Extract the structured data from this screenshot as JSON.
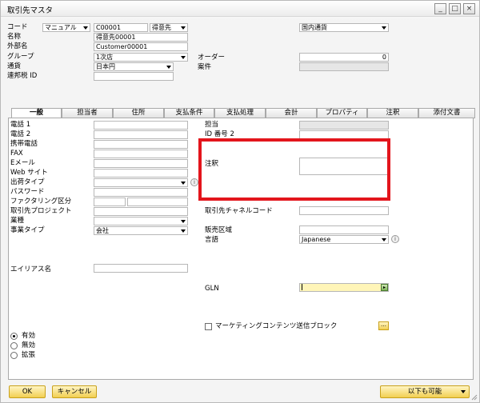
{
  "window": {
    "title": "取引先マスタ",
    "minimize_glyph": "_",
    "maximize_glyph": "□",
    "close_glyph": "×"
  },
  "header": {
    "code_label": "コード",
    "code_mode": "マニュアル",
    "code_value": "C00001",
    "type_value": "得意先",
    "name_label": "名称",
    "name_value": "得意先00001",
    "foreign_name_label": "外部名",
    "foreign_name_value": "Customer00001",
    "group_label": "グループ",
    "group_value": "1次店",
    "currency_label": "通貨",
    "currency_value": "日本円",
    "federal_tax_label": "連邦税 ID",
    "federal_tax_value": "",
    "currency_type_value": "国内通貨",
    "orders_label": "オーダー",
    "orders_value": "0",
    "projects_label": "案件",
    "projects_value": ""
  },
  "tabs": [
    "一般",
    "担当者",
    "住所",
    "支払条件",
    "支払処理",
    "会計",
    "プロパティ",
    "注釈",
    "添付文書"
  ],
  "general": {
    "left_labels": [
      "電話 1",
      "電話 2",
      "携帯電話",
      "FAX",
      "Eメール",
      "Web サイト",
      "出荷タイプ",
      "パスワード",
      "ファクタリング区分",
      "取引先プロジェクト",
      "業種",
      "事業タイプ"
    ],
    "business_type_value": "会社",
    "alias_label": "エイリアス名",
    "contact_label": "担当",
    "id2_label": "ID 番号 2",
    "remarks_label": "注釈",
    "bp_channel_label": "取引先チャネルコード",
    "territory_label": "販売区域",
    "language_label": "言語",
    "language_value": "Japanese",
    "gln_label": "GLN",
    "marketing_block_label": "マーケティングコンテンツ送信ブロック",
    "status_options": [
      "有効",
      "無効",
      "拡張"
    ]
  },
  "footer": {
    "ok_label": "OK",
    "cancel_label": "キャンセル",
    "copy_to_label": "以下も可能"
  },
  "icons": {
    "info": "info-circle-icon",
    "more": "ellipsis-icon",
    "gln": "gln-picker-icon"
  },
  "colors": {
    "highlight": "#e3151c",
    "button_fill": "#f2cf51",
    "readonly": "#e6e6e6"
  }
}
